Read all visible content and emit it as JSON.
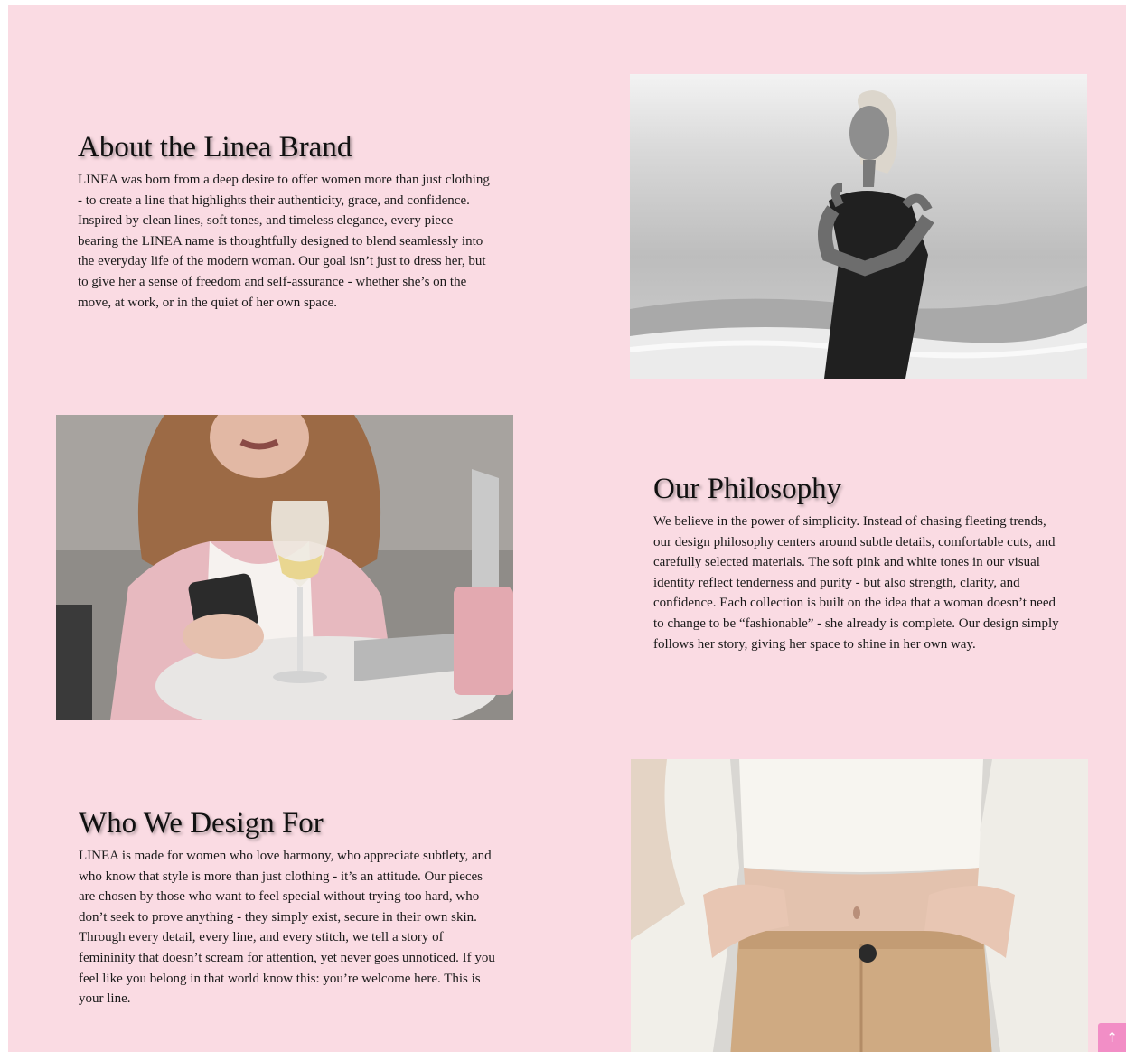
{
  "sections": {
    "about": {
      "title": "About the Linea Brand",
      "text": "LINEA was born from a deep desire to offer women more than just clothing - to create a line that highlights their authenticity, grace, and confidence. Inspired by clean lines, soft tones, and timeless elegance, every piece bearing the LINEA name is thoughtfully designed to blend seamlessly into the everyday life of the modern woman. Our goal isn’t just to dress her, but to give her a sense of freedom and self-assurance - whether she’s on the move, at work, or in the quiet of her own space."
    },
    "philosophy": {
      "title": "Our Philosophy",
      "text": "We believe in the power of simplicity. Instead of chasing fleeting trends, our design philosophy centers around subtle details, comfortable cuts, and carefully selected materials. The soft pink and white tones in our visual identity reflect tenderness and purity - but also strength, clarity, and confidence. Each collection is built on the idea that a woman doesn’t need to change to be “fashionable” - she already is complete. Our design simply follows her story, giving her space to shine in her own way."
    },
    "who": {
      "title": "Who We Design For",
      "text": "LINEA is made for women who love harmony, who appreciate subtlety, and who know that style is more than just clothing - it’s an attitude. Our pieces are chosen by those who want to feel special without trying too hard, who don’t seek to prove anything - they simply exist, secure in their own skin. Through every detail, every line, and every stitch, we tell a story of femininity that doesn’t scream for attention, yet never goes unnoticed. If you feel like you belong in that world know this: you’re welcome here. This is your line."
    }
  },
  "scroll_top": {
    "label": "↑"
  },
  "colors": {
    "page_background": "#fadbe3",
    "accent": "#f28ec6"
  }
}
